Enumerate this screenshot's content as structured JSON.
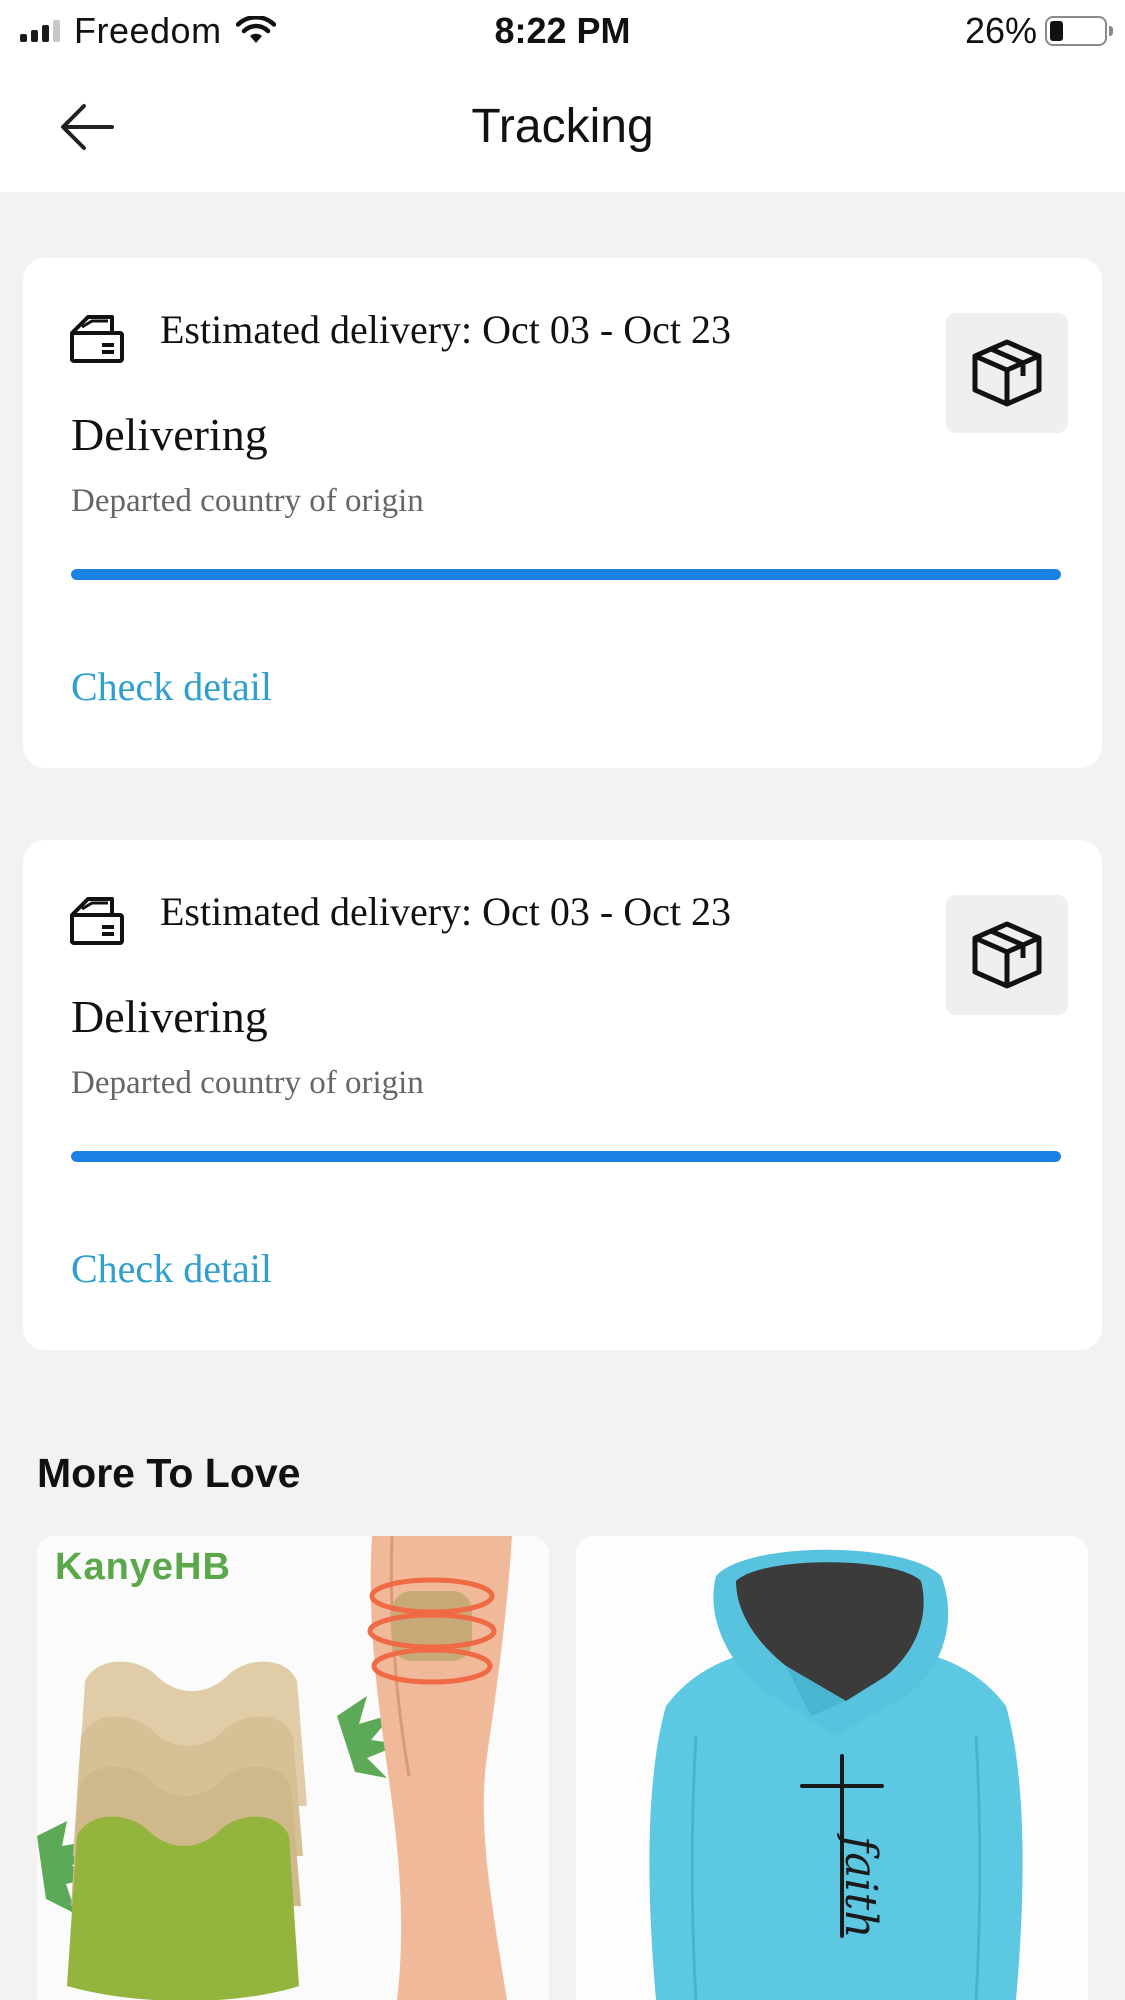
{
  "status_bar": {
    "carrier": "Freedom",
    "time": "8:22 PM",
    "battery_percent": "26%",
    "battery_level": 0.26,
    "signal_bars_active": 3,
    "signal_bars_total": 4
  },
  "header": {
    "title": "Tracking",
    "back_icon": "back-arrow-icon"
  },
  "shipments": [
    {
      "estimate": "Estimated delivery: Oct 03 - Oct 23",
      "status": "Delivering",
      "substatus": "Departed country of origin",
      "progress": 1.0,
      "action": "Check detail",
      "icon": "truck-icon",
      "side_icon": "package-icon"
    },
    {
      "estimate": "Estimated delivery: Oct 03 - Oct 23",
      "status": "Delivering",
      "substatus": "Departed country of origin",
      "progress": 1.0,
      "action": "Check detail",
      "icon": "truck-icon",
      "side_icon": "package-icon"
    }
  ],
  "recommendations": {
    "title": "More To Love",
    "products": [
      {
        "brand_logo": "KanyeHB",
        "image": "knee-patch-product-image"
      },
      {
        "image": "faith-hoodie-product-image",
        "print_text": "faith"
      }
    ]
  },
  "colors": {
    "accent_blue": "#1a82e2",
    "link_teal": "#2f9fcf",
    "background": "#f2f2f2",
    "brand_green": "#5aa84a",
    "hoodie_teal": "#5cc8e2"
  }
}
